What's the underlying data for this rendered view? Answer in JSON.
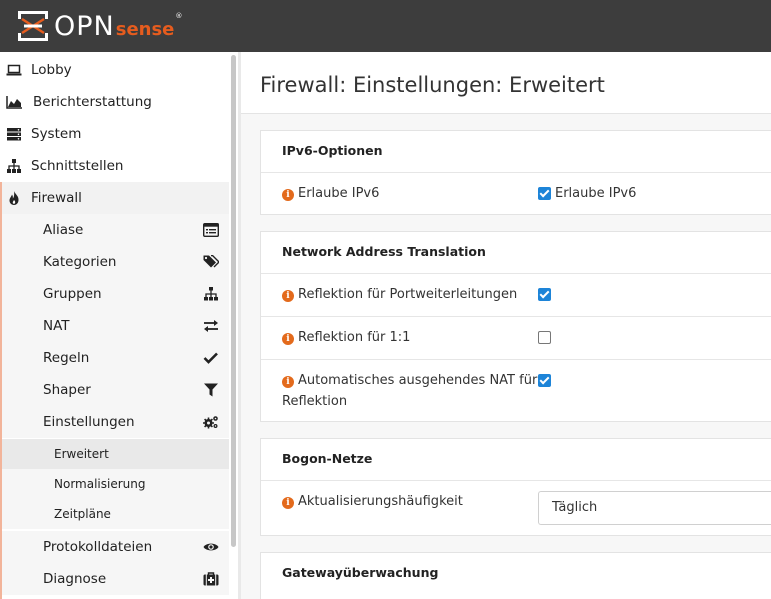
{
  "header": {
    "logo_opn": "OPN",
    "logo_sense": "sense",
    "logo_reg": "®"
  },
  "sidebar": {
    "items": [
      {
        "label": "Lobby",
        "icon": "laptop-icon"
      },
      {
        "label": "Berichterstattung",
        "icon": "area-chart-icon"
      },
      {
        "label": "System",
        "icon": "server-icon"
      },
      {
        "label": "Schnittstellen",
        "icon": "sitemap-icon"
      },
      {
        "label": "Firewall",
        "icon": "fire-icon"
      }
    ],
    "firewall_sub": [
      {
        "label": "Aliase",
        "icon": "list-alt-icon"
      },
      {
        "label": "Kategorien",
        "icon": "tags-icon"
      },
      {
        "label": "Gruppen",
        "icon": "sitemap-icon"
      },
      {
        "label": "NAT",
        "icon": "exchange-icon"
      },
      {
        "label": "Regeln",
        "icon": "check-icon"
      },
      {
        "label": "Shaper",
        "icon": "filter-icon"
      },
      {
        "label": "Einstellungen",
        "icon": "cogs-icon"
      }
    ],
    "einstellungen_sub": [
      {
        "label": "Erweitert",
        "active": true
      },
      {
        "label": "Normalisierung",
        "active": false
      },
      {
        "label": "Zeitpläne",
        "active": false
      }
    ],
    "firewall_sub_after": [
      {
        "label": "Protokolldateien",
        "icon": "eye-icon"
      },
      {
        "label": "Diagnose",
        "icon": "medkit-icon"
      }
    ]
  },
  "page": {
    "title": "Firewall: Einstellungen: Erweitert"
  },
  "sections": {
    "ipv6": {
      "heading": "IPv6-Optionen",
      "rows": [
        {
          "label": "Erlaube IPv6",
          "checked": true,
          "checkbox_label": "Erlaube IPv6"
        }
      ]
    },
    "nat": {
      "heading": "Network Address Translation",
      "rows": [
        {
          "label": "Reflektion für Portweiterleitungen",
          "checked": true
        },
        {
          "label": "Reflektion für 1:1",
          "checked": false
        },
        {
          "label_line1": "Automatisches ausgehendes NAT für",
          "label_line2": "Reflektion",
          "checked": true
        }
      ]
    },
    "bogon": {
      "heading": "Bogon-Netze",
      "rows": [
        {
          "label": "Aktualisierungshäufigkeit",
          "value": "Täglich"
        }
      ]
    },
    "gateway": {
      "heading": "Gatewayüberwachung"
    }
  },
  "colors": {
    "header_bg": "#3d3d3d",
    "accent_orange": "#e36a1c",
    "checkbox_blue": "#1d84d8"
  }
}
